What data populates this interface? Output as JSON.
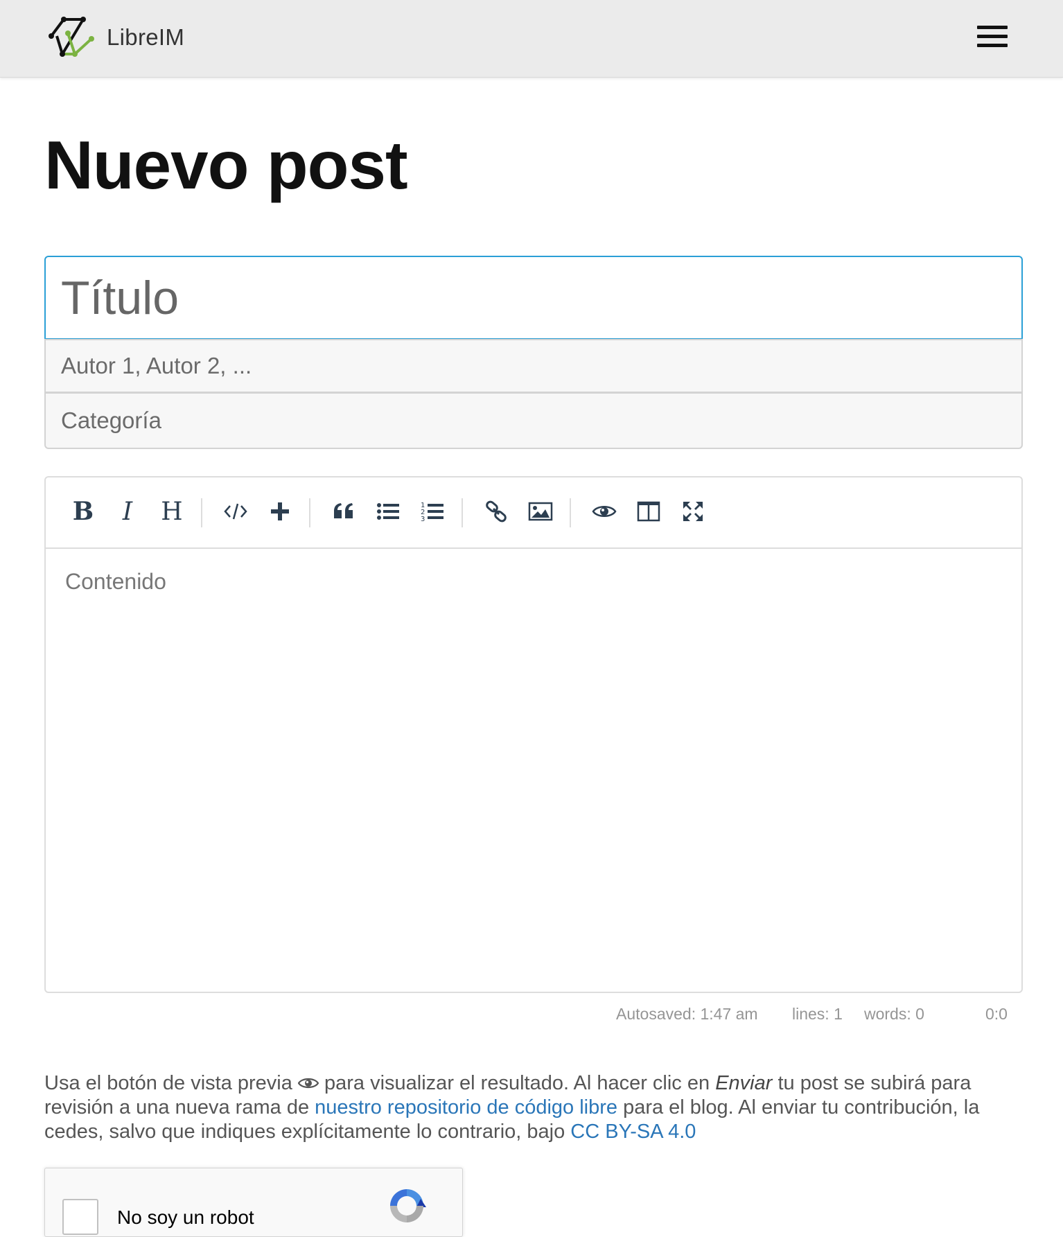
{
  "header": {
    "brand_name": "LibreIM",
    "logo_icon": "libreim-logo-icon",
    "menu_icon": "hamburger-menu-icon"
  },
  "page": {
    "title": "Nuevo post"
  },
  "form": {
    "title_placeholder": "Título",
    "authors_placeholder": "Autor 1, Autor 2, ...",
    "category_placeholder": "Categoría"
  },
  "editor": {
    "toolbar": {
      "bold_label": "B",
      "italic_label": "I",
      "heading_label": "H",
      "icons": [
        "bold-icon",
        "italic-icon",
        "heading-icon",
        "code-icon",
        "plus-icon",
        "quote-icon",
        "unordered-list-icon",
        "ordered-list-icon",
        "link-icon",
        "image-icon",
        "preview-eye-icon",
        "side-by-side-icon",
        "fullscreen-icon"
      ]
    },
    "placeholder": "Contenido",
    "status": {
      "autosaved": "Autosaved: 1:47 am",
      "lines": "lines: 1",
      "words": "words: 0",
      "cursor": "0:0"
    }
  },
  "notice": {
    "part1": "Usa el botón de vista previa",
    "part2": "para visualizar el resultado. Al hacer clic en",
    "enviar": "Enviar",
    "part3": "tu post se subirá para revisión a una nueva rama de",
    "repo_link": "nuestro repositorio de código libre",
    "part4": "para el blog. Al enviar tu contribución, la cedes, salvo que indiques explícitamente lo contrario, bajo",
    "license_link": "CC BY-SA 4.0"
  },
  "recaptcha": {
    "label": "No soy un robot"
  },
  "colors": {
    "navbar_bg": "#ebebeb",
    "focus_border": "#2a9fd6",
    "link": "#2a76b8",
    "logo_green": "#7cb342",
    "toolbar_icon": "#2c3e50"
  }
}
